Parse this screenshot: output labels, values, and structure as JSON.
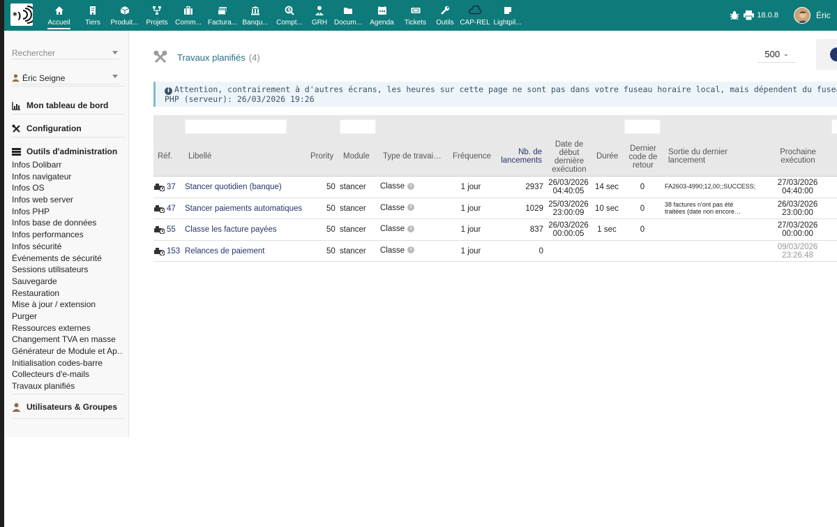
{
  "topbar": {
    "menu": [
      {
        "label": "Accueil",
        "icon": "home-icon",
        "active": true
      },
      {
        "label": "Tiers",
        "icon": "building-icon"
      },
      {
        "label": "Produit...",
        "icon": "cube-icon"
      },
      {
        "label": "Projets",
        "icon": "sitemap-icon"
      },
      {
        "label": "Comm...",
        "icon": "suitcase-icon"
      },
      {
        "label": "Factura...",
        "icon": "money-icon"
      },
      {
        "label": "Banqu...",
        "icon": "bank-icon"
      },
      {
        "label": "Compt...",
        "icon": "search-dollar-icon"
      },
      {
        "label": "GRH",
        "icon": "user-tie-icon"
      },
      {
        "label": "Docum...",
        "icon": "folder-icon"
      },
      {
        "label": "Agenda",
        "icon": "calendar-icon"
      },
      {
        "label": "Tickets",
        "icon": "ticket-icon"
      },
      {
        "label": "Outils",
        "icon": "wrench-icon"
      },
      {
        "label": "CAP-REL",
        "icon": "cloud-icon"
      },
      {
        "label": "Lightpil...",
        "icon": "note-icon"
      }
    ],
    "version": "18.0.8",
    "user_name": "Éric"
  },
  "sidebar": {
    "search_placeholder": "Rechercher",
    "user_select": "Éric Seigne",
    "section_dashboard": "Mon tableau de bord",
    "section_config": "Configuration",
    "section_admin": "Outils d'administration",
    "admin_links": [
      "Infos Dolibarr",
      "Infos navigateur",
      "Infos OS",
      "Infos web server",
      "Infos PHP",
      "Infos base de données",
      "Infos performances",
      "Infos sécurité",
      "Événements de sécurité",
      "Sessions utilisateurs",
      "Sauvegarde",
      "Restauration",
      "Mise à jour / extension",
      "Purger",
      "Ressources externes",
      "Changement TVA en masse",
      "Générateur de Module et Ap…",
      "Initialisation codes-barre",
      "Collecteurs d'e-mails",
      "Travaux planifiés"
    ],
    "section_users": "Utilisateurs & Groupes"
  },
  "main": {
    "title": "Travaux planifiés",
    "count": "(4)",
    "limit": "500",
    "warning": "Attention, contrairement à d'autres écrans, les heures sur cette page ne sont pas dans votre fuseau horaire local, mais dépendent du fuseau horaire du serveur. Heu",
    "warning_line2": "PHP (serveur): 26/03/2026 19:26",
    "table": {
      "headers": {
        "ref": "Réf.",
        "label": "Libellé",
        "priority": "Prority",
        "module": "Module",
        "type": "Type de travai…",
        "frequency": "Fréquence",
        "nb_launch_1": "Nb. de",
        "nb_launch_2": "lancements",
        "start_1": "Date de",
        "start_2": "début",
        "start_3": "dernière",
        "start_4": "exécution",
        "duration": "Durée",
        "retcode_1": "Dernier",
        "retcode_2": "code de",
        "retcode_3": "retour",
        "output_1": "Sortie du dernier",
        "output_2": "lancement",
        "next_1": "Prochaine",
        "next_2": "exécution"
      },
      "rows": [
        {
          "ref": "37",
          "label": "Stancer quotidien (banque)",
          "priority": "50",
          "module": "stancer",
          "type": "Classe",
          "frequency": "1 jour",
          "nb": "2937",
          "start_date": "26/03/2026",
          "start_time": "04:40:05",
          "duration": "14 sec",
          "retcode": "0",
          "output_1": "FA2603-4990;12,00;;SUCCESS;",
          "output_2": "",
          "next_date": "27/03/2026",
          "next_time": "04:40:00"
        },
        {
          "ref": "47",
          "label": "Stancer paiements automatiques",
          "priority": "50",
          "module": "stancer",
          "type": "Classe",
          "frequency": "1 jour",
          "nb": "1029",
          "start_date": "25/03/2026",
          "start_time": "23:00:09",
          "duration": "10 sec",
          "retcode": "0",
          "output_1": "38 factures n'ont pas été",
          "output_2": "traitées (date non encore…",
          "next_date": "26/03/2026",
          "next_time": "23:00:00"
        },
        {
          "ref": "55",
          "label": "Classe les facture payées",
          "priority": "50",
          "module": "stancer",
          "type": "Classe",
          "frequency": "1 jour",
          "nb": "837",
          "start_date": "26/03/2026",
          "start_time": "00:00:05",
          "duration": "1 sec",
          "retcode": "0",
          "output_1": "",
          "output_2": "",
          "next_date": "27/03/2026",
          "next_time": "00:00:00"
        },
        {
          "ref": "153",
          "label": "Relances de paiement",
          "priority": "50",
          "module": "stancer",
          "type": "Classe",
          "frequency": "1 jour",
          "nb": "0",
          "start_date": "",
          "start_time": "",
          "duration": "",
          "retcode": "",
          "output_1": "",
          "output_2": "",
          "next_date": "09/03/2026",
          "next_time": "23:26:48"
        }
      ]
    }
  },
  "colors": {
    "topbar": "#0e7a7a",
    "link": "#25346b",
    "title": "#2a6f87"
  }
}
